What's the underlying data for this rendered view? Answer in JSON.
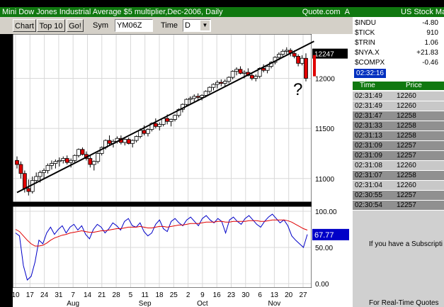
{
  "window": {
    "title": "Mini Dow Jones Industrial Average $5 multiplier,Dec-2006, Daily",
    "provider": "Quote.com",
    "corner_letter": "A"
  },
  "toolbar": {
    "chart_button": "Chart",
    "top10_button": "Top 10",
    "go_button": "Go!",
    "sym_label": "Sym",
    "sym_value": "YM06Z",
    "time_label": "Time",
    "time_value": "D"
  },
  "annotation": {
    "question_mark": "?"
  },
  "colors": {
    "up": "#ffffff",
    "down": "#e00000",
    "blue": "#0000c8",
    "red": "#e00000",
    "accent_green": "#107810"
  },
  "chart_data": [
    {
      "type": "candlestick",
      "title": "Mini Dow Jones Industrial Average $5 multiplier,Dec-2006, Daily",
      "ylim": [
        10800,
        12400
      ],
      "y_ticks": [
        11000,
        11500,
        12000
      ],
      "last_price_label": "12247",
      "x_tick_labels": [
        "10",
        "17",
        "24",
        "31",
        "7",
        "14",
        "21",
        "28",
        "5",
        "11",
        "18",
        "25",
        "2",
        "9",
        "16",
        "23",
        "30",
        "6",
        "13",
        "20",
        "27"
      ],
      "month_labels": [
        "Aug",
        "Sep",
        "Oct",
        "Nov"
      ],
      "grid": true,
      "candles": [
        [
          11180,
          11220,
          11100,
          11140
        ],
        [
          11140,
          11170,
          11000,
          11050
        ],
        [
          11050,
          11080,
          10860,
          10900
        ],
        [
          10900,
          10990,
          10830,
          10870
        ],
        [
          10870,
          11020,
          10850,
          10980
        ],
        [
          10980,
          11060,
          10950,
          11020
        ],
        [
          11020,
          11080,
          10960,
          11060
        ],
        [
          11060,
          11100,
          11000,
          11080
        ],
        [
          11080,
          11150,
          11050,
          11130
        ],
        [
          11130,
          11180,
          11090,
          11150
        ],
        [
          11150,
          11190,
          11100,
          11170
        ],
        [
          11170,
          11210,
          11120,
          11180
        ],
        [
          11180,
          11220,
          11150,
          11200
        ],
        [
          11200,
          11230,
          11140,
          11160
        ],
        [
          11160,
          11200,
          11110,
          11180
        ],
        [
          11180,
          11240,
          11160,
          11230
        ],
        [
          11230,
          11300,
          11210,
          11290
        ],
        [
          11290,
          11310,
          11230,
          11240
        ],
        [
          11240,
          11270,
          11180,
          11200
        ],
        [
          11200,
          11230,
          11110,
          11140
        ],
        [
          11140,
          11180,
          11080,
          11170
        ],
        [
          11170,
          11260,
          11150,
          11250
        ],
        [
          11250,
          11320,
          11230,
          11310
        ],
        [
          11310,
          11390,
          11290,
          11380
        ],
        [
          11380,
          11430,
          11330,
          11350
        ],
        [
          11350,
          11390,
          11310,
          11370
        ],
        [
          11370,
          11420,
          11350,
          11400
        ],
        [
          11400,
          11430,
          11340,
          11360
        ],
        [
          11360,
          11400,
          11330,
          11390
        ],
        [
          11390,
          11410,
          11340,
          11350
        ],
        [
          11350,
          11390,
          11310,
          11380
        ],
        [
          11380,
          11430,
          11360,
          11420
        ],
        [
          11420,
          11500,
          11400,
          11480
        ],
        [
          11480,
          11530,
          11430,
          11450
        ],
        [
          11450,
          11500,
          11420,
          11490
        ],
        [
          11490,
          11560,
          11470,
          11550
        ],
        [
          11550,
          11600,
          11500,
          11520
        ],
        [
          11520,
          11560,
          11480,
          11540
        ],
        [
          11540,
          11610,
          11520,
          11600
        ],
        [
          11600,
          11640,
          11540,
          11570
        ],
        [
          11570,
          11600,
          11520,
          11590
        ],
        [
          11590,
          11640,
          11570,
          11630
        ],
        [
          11630,
          11700,
          11610,
          11690
        ],
        [
          11690,
          11750,
          11660,
          11740
        ],
        [
          11740,
          11800,
          11720,
          11790
        ],
        [
          11790,
          11820,
          11750,
          11800
        ],
        [
          11800,
          11840,
          11770,
          11820
        ],
        [
          11820,
          11850,
          11780,
          11810
        ],
        [
          11810,
          11840,
          11780,
          11830
        ],
        [
          11830,
          11880,
          11810,
          11870
        ],
        [
          11870,
          11920,
          11850,
          11910
        ],
        [
          11910,
          11950,
          11880,
          11940
        ],
        [
          11940,
          11980,
          11900,
          11960
        ],
        [
          11960,
          11990,
          11920,
          11950
        ],
        [
          11950,
          11990,
          11920,
          11970
        ],
        [
          11970,
          12020,
          11950,
          12010
        ],
        [
          12010,
          12080,
          11990,
          12070
        ],
        [
          12070,
          12110,
          12030,
          12090
        ],
        [
          12090,
          12120,
          12040,
          12050
        ],
        [
          12050,
          12080,
          12000,
          12060
        ],
        [
          12060,
          12100,
          12020,
          12030
        ],
        [
          12030,
          12060,
          11980,
          12000
        ],
        [
          12000,
          12040,
          11970,
          12020
        ],
        [
          12020,
          12110,
          12000,
          12100
        ],
        [
          12100,
          12140,
          12060,
          12080
        ],
        [
          12080,
          12130,
          12050,
          12120
        ],
        [
          12120,
          12170,
          12100,
          12160
        ],
        [
          12160,
          12220,
          12140,
          12210
        ],
        [
          12210,
          12260,
          12180,
          12240
        ],
        [
          12240,
          12290,
          12210,
          12270
        ],
        [
          12270,
          12310,
          12240,
          12280
        ],
        [
          12280,
          12300,
          12220,
          12250
        ],
        [
          12250,
          12280,
          12200,
          12220
        ],
        [
          12220,
          12240,
          12120,
          12150
        ],
        [
          12150,
          12230,
          12130,
          12200
        ],
        [
          12200,
          12250,
          11970,
          12000
        ]
      ],
      "trendline": [
        [
          0,
          10860
        ],
        [
          76,
          12370
        ]
      ]
    },
    {
      "type": "line",
      "ylim": [
        0,
        100
      ],
      "y_ticks": [
        "100.00",
        "50.00",
        "0.00"
      ],
      "last_value_label": "67.77",
      "series": [
        {
          "values": [
            70,
            66,
            25,
            5,
            10,
            30,
            60,
            55,
            70,
            78,
            68,
            75,
            80,
            70,
            78,
            82,
            74,
            80,
            68,
            62,
            75,
            82,
            78,
            70,
            76,
            84,
            80,
            74,
            86,
            90,
            80,
            78,
            84,
            72,
            66,
            70,
            82,
            88,
            76,
            72,
            86,
            90,
            84,
            80,
            88,
            92,
            86,
            80,
            90,
            94,
            88,
            84,
            90,
            86,
            70,
            88,
            92,
            86,
            82,
            90,
            94,
            88,
            82,
            78,
            86,
            92,
            96,
            90,
            84,
            88,
            80,
            66,
            60,
            55,
            50,
            68
          ]
        },
        {
          "values": [
            75,
            72,
            66,
            60,
            55,
            52,
            52,
            53,
            56,
            60,
            63,
            65,
            67,
            68,
            70,
            71,
            72,
            73,
            72,
            71,
            71,
            72,
            73,
            73,
            74,
            75,
            76,
            76,
            77,
            78,
            78,
            78,
            79,
            78,
            77,
            77,
            78,
            79,
            79,
            78,
            79,
            80,
            81,
            81,
            82,
            83,
            83,
            83,
            84,
            85,
            85,
            85,
            86,
            86,
            85,
            85,
            86,
            86,
            86,
            86,
            87,
            87,
            87,
            86,
            86,
            87,
            88,
            88,
            88,
            88,
            87,
            85,
            82,
            79,
            76,
            74
          ]
        }
      ]
    }
  ],
  "sidebar": {
    "header": "US Stock Mar",
    "quotes": [
      {
        "sym": "$INDU",
        "val": "-4.80"
      },
      {
        "sym": "$TICK",
        "val": "910"
      },
      {
        "sym": "$TRIN",
        "val": "1.06"
      },
      {
        "sym": "$NYA.X",
        "val": "+21.83"
      },
      {
        "sym": "$COMPX",
        "val": "-0.46"
      }
    ],
    "clock": "02:32:16",
    "time_header": "Time",
    "price_header": "Price",
    "trades": [
      {
        "time": "02:31:49",
        "price": "12260",
        "shade": "#c8c8c8"
      },
      {
        "time": "02:31:49",
        "price": "12260",
        "shade": "#c8c8c8"
      },
      {
        "time": "02:31:47",
        "price": "12258",
        "shade": "#909090"
      },
      {
        "time": "02:31:33",
        "price": "12258",
        "shade": "#909090"
      },
      {
        "time": "02:31:13",
        "price": "12258",
        "shade": "#909090"
      },
      {
        "time": "02:31:09",
        "price": "12257",
        "shade": "#909090"
      },
      {
        "time": "02:31:09",
        "price": "12257",
        "shade": "#909090"
      },
      {
        "time": "02:31:08",
        "price": "12260",
        "shade": "#c8c8c8"
      },
      {
        "time": "02:31:07",
        "price": "12258",
        "shade": "#909090"
      },
      {
        "time": "02:31:04",
        "price": "12260",
        "shade": "#c8c8c8"
      },
      {
        "time": "02:30:55",
        "price": "12257",
        "shade": "#909090"
      },
      {
        "time": "02:30:54",
        "price": "12257",
        "shade": "#909090"
      }
    ],
    "message1": "If you have a Subscripti",
    "message2": "For Real-Time Quotes"
  }
}
